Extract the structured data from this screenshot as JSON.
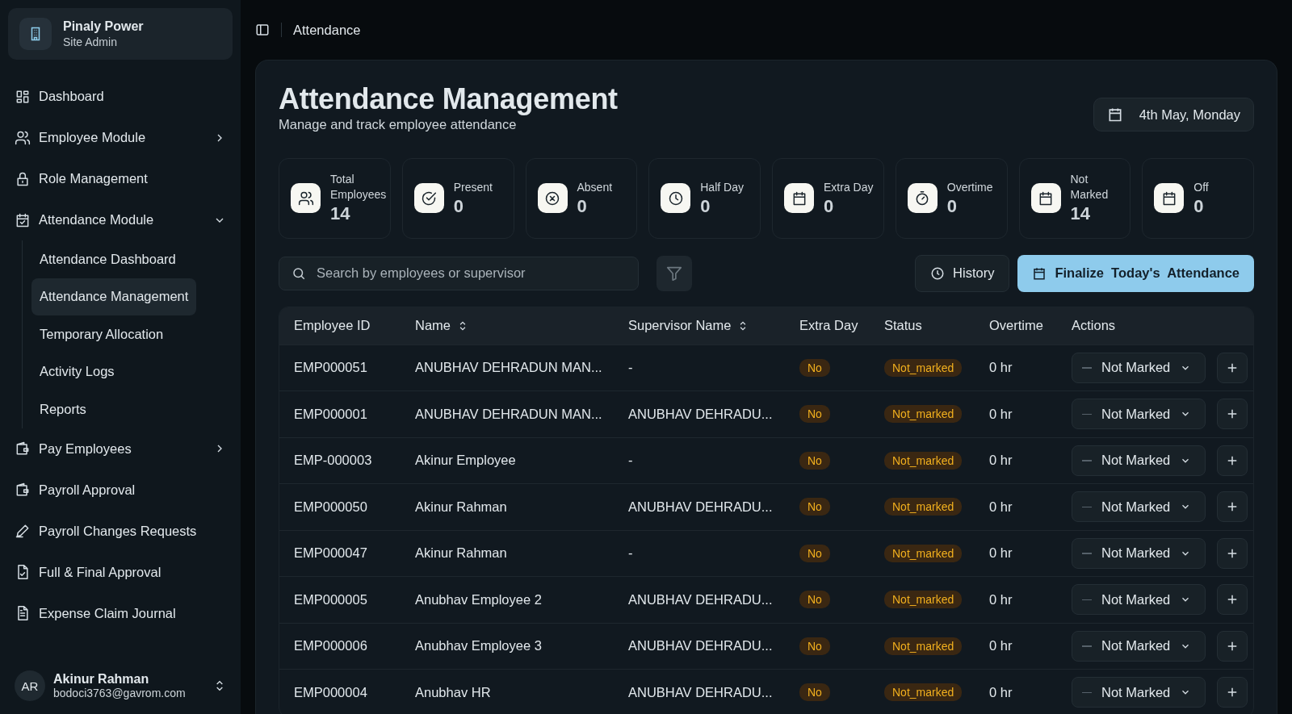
{
  "org": {
    "name": "Pinaly Power",
    "role": "Site Admin"
  },
  "sidebar": {
    "items": [
      {
        "label": "Dashboard",
        "kind": "link"
      },
      {
        "label": "Employee Module",
        "kind": "group",
        "expanded": false
      },
      {
        "label": "Role Management",
        "kind": "link"
      },
      {
        "label": "Attendance Module",
        "kind": "group",
        "expanded": true,
        "children": [
          {
            "label": "Attendance Dashboard",
            "selected": false
          },
          {
            "label": "Attendance Management",
            "selected": true
          },
          {
            "label": "Temporary Allocation",
            "selected": false
          },
          {
            "label": "Activity Logs",
            "selected": false
          },
          {
            "label": "Reports",
            "selected": false
          }
        ]
      },
      {
        "label": "Pay Employees",
        "kind": "group",
        "expanded": false
      },
      {
        "label": "Payroll Approval",
        "kind": "link"
      },
      {
        "label": "Payroll Changes Requests",
        "kind": "link"
      },
      {
        "label": "Full & Final Approval",
        "kind": "link"
      },
      {
        "label": "Expense Claim Journal",
        "kind": "link"
      }
    ]
  },
  "user": {
    "initials": "AR",
    "name": "Akinur Rahman",
    "email": "bodoci3763@gavrom.com"
  },
  "breadcrumb": "Attendance",
  "page": {
    "title": "Attendance Management",
    "subtitle": "Manage and track employee attendance",
    "date": "4th May, Monday"
  },
  "stats": [
    {
      "label": "Total Employees",
      "value": "14"
    },
    {
      "label": "Present",
      "value": "0"
    },
    {
      "label": "Absent",
      "value": "0"
    },
    {
      "label": "Half Day",
      "value": "0"
    },
    {
      "label": "Extra Day",
      "value": "0"
    },
    {
      "label": "Overtime",
      "value": "0"
    },
    {
      "label": "Not Marked",
      "value": "14"
    },
    {
      "label": "Off",
      "value": "0"
    }
  ],
  "search": {
    "placeholder": "Search by employees or supervisor"
  },
  "buttons": {
    "history": "History",
    "finalize": "Finalize  Today's  Attendance"
  },
  "table": {
    "columns": [
      {
        "label": "Employee ID",
        "sortable": false
      },
      {
        "label": "Name",
        "sortable": true
      },
      {
        "label": "Supervisor Name",
        "sortable": true
      },
      {
        "label": "Extra Day",
        "sortable": false
      },
      {
        "label": "Status",
        "sortable": false
      },
      {
        "label": "Overtime",
        "sortable": false
      },
      {
        "label": "Actions",
        "sortable": false
      }
    ],
    "rows": [
      {
        "id": "EMP000051",
        "name": "ANUBHAV DEHRADUN MAN...",
        "supervisor": "-",
        "extra_day": "No",
        "status": "Not_marked",
        "overtime": "0 hr",
        "action": "Not Marked"
      },
      {
        "id": "EMP000001",
        "name": "ANUBHAV DEHRADUN MAN...",
        "supervisor": "ANUBHAV DEHRADU...",
        "extra_day": "No",
        "status": "Not_marked",
        "overtime": "0 hr",
        "action": "Not Marked"
      },
      {
        "id": "EMP-000003",
        "name": "Akinur Employee",
        "supervisor": "-",
        "extra_day": "No",
        "status": "Not_marked",
        "overtime": "0 hr",
        "action": "Not Marked"
      },
      {
        "id": "EMP000050",
        "name": "Akinur Rahman",
        "supervisor": "ANUBHAV DEHRADU...",
        "extra_day": "No",
        "status": "Not_marked",
        "overtime": "0 hr",
        "action": "Not Marked"
      },
      {
        "id": "EMP000047",
        "name": "Akinur Rahman",
        "supervisor": "-",
        "extra_day": "No",
        "status": "Not_marked",
        "overtime": "0 hr",
        "action": "Not Marked"
      },
      {
        "id": "EMP000005",
        "name": "Anubhav Employee 2",
        "supervisor": "ANUBHAV DEHRADU...",
        "extra_day": "No",
        "status": "Not_marked",
        "overtime": "0 hr",
        "action": "Not Marked"
      },
      {
        "id": "EMP000006",
        "name": "Anubhav Employee 3",
        "supervisor": "ANUBHAV DEHRADU...",
        "extra_day": "No",
        "status": "Not_marked",
        "overtime": "0 hr",
        "action": "Not Marked"
      },
      {
        "id": "EMP000004",
        "name": "Anubhav HR",
        "supervisor": "ANUBHAV DEHRADU...",
        "extra_day": "No",
        "status": "Not_marked",
        "overtime": "0 hr",
        "action": "Not Marked"
      }
    ]
  }
}
